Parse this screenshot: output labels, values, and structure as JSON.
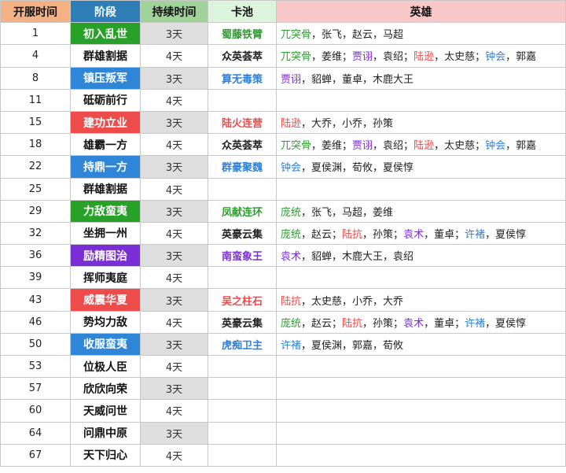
{
  "headers": [
    "开服时间",
    "阶段",
    "持续时间",
    "卡池",
    "英雄"
  ],
  "colors": {
    "green": "#2e9b2e",
    "red": "#ea4a4a",
    "blue": "#2f7fd8",
    "purple": "#7a2fd6",
    "black": "#222222"
  },
  "rows": [
    {
      "day": "1",
      "stage": "初入乱世",
      "stage_color": "green",
      "duration": "3天",
      "pool": "蜀藤铁臂",
      "pool_color": "green",
      "heroes": [
        {
          "t": "兀突骨",
          "c": "green"
        },
        {
          "t": "，张飞，赵云，马超",
          "c": "black"
        }
      ]
    },
    {
      "day": "4",
      "stage": "群雄割据",
      "stage_color": "none",
      "duration": "4天",
      "pool": "众英荟萃",
      "pool_color": "black",
      "heroes": [
        {
          "t": "兀突骨",
          "c": "green"
        },
        {
          "t": "，姜维；",
          "c": "black"
        },
        {
          "t": "贾诩",
          "c": "purple"
        },
        {
          "t": "，袁绍；",
          "c": "black"
        },
        {
          "t": "陆逊",
          "c": "red"
        },
        {
          "t": "，太史慈；",
          "c": "black"
        },
        {
          "t": "钟会",
          "c": "blue"
        },
        {
          "t": "，郭嘉",
          "c": "black"
        }
      ]
    },
    {
      "day": "8",
      "stage": "镇压叛军",
      "stage_color": "blue",
      "duration": "3天",
      "pool": "算无毒策",
      "pool_color": "blue",
      "heroes": [
        {
          "t": "贾诩",
          "c": "purple"
        },
        {
          "t": "，貂蝉，董卓，木鹿大王",
          "c": "black"
        }
      ]
    },
    {
      "day": "11",
      "stage": "砥砺前行",
      "stage_color": "none",
      "duration": "4天",
      "pool": "",
      "pool_color": "black",
      "heroes": []
    },
    {
      "day": "15",
      "stage": "建功立业",
      "stage_color": "red",
      "duration": "3天",
      "pool": "陆火连营",
      "pool_color": "red",
      "heroes": [
        {
          "t": "陆逊",
          "c": "red"
        },
        {
          "t": "，大乔，小乔，孙策",
          "c": "black"
        }
      ]
    },
    {
      "day": "18",
      "stage": "雄霸一方",
      "stage_color": "none",
      "duration": "4天",
      "pool": "众英荟萃",
      "pool_color": "black",
      "heroes": [
        {
          "t": "兀突骨",
          "c": "green"
        },
        {
          "t": "，姜维；",
          "c": "black"
        },
        {
          "t": "贾诩",
          "c": "purple"
        },
        {
          "t": "，袁绍；",
          "c": "black"
        },
        {
          "t": "陆逊",
          "c": "red"
        },
        {
          "t": "，太史慈；",
          "c": "black"
        },
        {
          "t": "钟会",
          "c": "blue"
        },
        {
          "t": "，郭嘉",
          "c": "black"
        }
      ]
    },
    {
      "day": "22",
      "stage": "持鼎一方",
      "stage_color": "blue",
      "duration": "3天",
      "pool": "群豪聚魏",
      "pool_color": "blue",
      "heroes": [
        {
          "t": "钟会",
          "c": "blue"
        },
        {
          "t": "，夏侯渊，荀攸，夏侯惇",
          "c": "black"
        }
      ]
    },
    {
      "day": "25",
      "stage": "群雄割据",
      "stage_color": "none",
      "duration": "4天",
      "pool": "",
      "pool_color": "black",
      "heroes": []
    },
    {
      "day": "29",
      "stage": "力敌蛮夷",
      "stage_color": "green",
      "duration": "3天",
      "pool": "凤献连环",
      "pool_color": "green",
      "heroes": [
        {
          "t": "庞统",
          "c": "green"
        },
        {
          "t": "，张飞，马超，姜维",
          "c": "black"
        }
      ]
    },
    {
      "day": "32",
      "stage": "坐拥一州",
      "stage_color": "none",
      "duration": "4天",
      "pool": "英豪云集",
      "pool_color": "black",
      "heroes": [
        {
          "t": "庞统",
          "c": "green"
        },
        {
          "t": "，赵云；",
          "c": "black"
        },
        {
          "t": "陆抗",
          "c": "red"
        },
        {
          "t": "，孙策；",
          "c": "black"
        },
        {
          "t": "袁术",
          "c": "purple"
        },
        {
          "t": "，董卓；",
          "c": "black"
        },
        {
          "t": "许褚",
          "c": "blue"
        },
        {
          "t": "，夏侯惇",
          "c": "black"
        }
      ]
    },
    {
      "day": "36",
      "stage": "励精图治",
      "stage_color": "purple",
      "duration": "3天",
      "pool": "南蛮象王",
      "pool_color": "purple",
      "heroes": [
        {
          "t": "袁术",
          "c": "purple"
        },
        {
          "t": "，貂蝉，木鹿大王，袁绍",
          "c": "black"
        }
      ]
    },
    {
      "day": "39",
      "stage": "挥师夷庭",
      "stage_color": "none",
      "duration": "4天",
      "pool": "",
      "pool_color": "black",
      "heroes": []
    },
    {
      "day": "43",
      "stage": "威震华夏",
      "stage_color": "red",
      "duration": "3天",
      "pool": "吴之柱石",
      "pool_color": "red",
      "heroes": [
        {
          "t": "陆抗",
          "c": "red"
        },
        {
          "t": "，太史慈，小乔，大乔",
          "c": "black"
        }
      ]
    },
    {
      "day": "46",
      "stage": "势均力敌",
      "stage_color": "none",
      "duration": "4天",
      "pool": "英豪云集",
      "pool_color": "black",
      "heroes": [
        {
          "t": "庞统",
          "c": "green"
        },
        {
          "t": "，赵云；",
          "c": "black"
        },
        {
          "t": "陆抗",
          "c": "red"
        },
        {
          "t": "，孙策；",
          "c": "black"
        },
        {
          "t": "袁术",
          "c": "purple"
        },
        {
          "t": "，董卓；",
          "c": "black"
        },
        {
          "t": "许褚",
          "c": "blue"
        },
        {
          "t": "，夏侯惇",
          "c": "black"
        }
      ]
    },
    {
      "day": "50",
      "stage": "收服蛮夷",
      "stage_color": "blue",
      "duration": "3天",
      "pool": "虎痴卫主",
      "pool_color": "blue",
      "heroes": [
        {
          "t": "许褚",
          "c": "blue"
        },
        {
          "t": "，夏侯渊，郭嘉，荀攸",
          "c": "black"
        }
      ]
    },
    {
      "day": "53",
      "stage": "位极人臣",
      "stage_color": "none",
      "duration": "4天",
      "pool": "",
      "pool_color": "black",
      "heroes": []
    },
    {
      "day": "57",
      "stage": "欣欣向荣",
      "stage_color": "none",
      "duration": "3天",
      "pool": "",
      "pool_color": "black",
      "heroes": []
    },
    {
      "day": "60",
      "stage": "天威问世",
      "stage_color": "none",
      "duration": "4天",
      "pool": "",
      "pool_color": "black",
      "heroes": []
    },
    {
      "day": "64",
      "stage": "问鼎中原",
      "stage_color": "none",
      "duration": "3天",
      "pool": "",
      "pool_color": "black",
      "heroes": []
    },
    {
      "day": "67",
      "stage": "天下归心",
      "stage_color": "none",
      "duration": "4天",
      "pool": "",
      "pool_color": "black",
      "heroes": []
    }
  ]
}
